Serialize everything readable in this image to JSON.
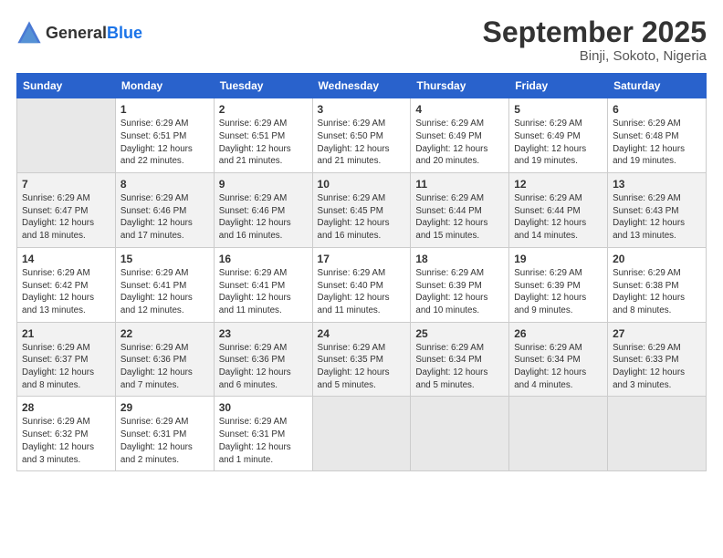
{
  "header": {
    "logo_general": "General",
    "logo_blue": "Blue",
    "month": "September 2025",
    "location": "Binji, Sokoto, Nigeria"
  },
  "weekdays": [
    "Sunday",
    "Monday",
    "Tuesday",
    "Wednesday",
    "Thursday",
    "Friday",
    "Saturday"
  ],
  "weeks": [
    [
      {
        "day": "",
        "info": ""
      },
      {
        "day": "1",
        "info": "Sunrise: 6:29 AM\nSunset: 6:51 PM\nDaylight: 12 hours\nand 22 minutes."
      },
      {
        "day": "2",
        "info": "Sunrise: 6:29 AM\nSunset: 6:51 PM\nDaylight: 12 hours\nand 21 minutes."
      },
      {
        "day": "3",
        "info": "Sunrise: 6:29 AM\nSunset: 6:50 PM\nDaylight: 12 hours\nand 21 minutes."
      },
      {
        "day": "4",
        "info": "Sunrise: 6:29 AM\nSunset: 6:49 PM\nDaylight: 12 hours\nand 20 minutes."
      },
      {
        "day": "5",
        "info": "Sunrise: 6:29 AM\nSunset: 6:49 PM\nDaylight: 12 hours\nand 19 minutes."
      },
      {
        "day": "6",
        "info": "Sunrise: 6:29 AM\nSunset: 6:48 PM\nDaylight: 12 hours\nand 19 minutes."
      }
    ],
    [
      {
        "day": "7",
        "info": "Sunrise: 6:29 AM\nSunset: 6:47 PM\nDaylight: 12 hours\nand 18 minutes."
      },
      {
        "day": "8",
        "info": "Sunrise: 6:29 AM\nSunset: 6:46 PM\nDaylight: 12 hours\nand 17 minutes."
      },
      {
        "day": "9",
        "info": "Sunrise: 6:29 AM\nSunset: 6:46 PM\nDaylight: 12 hours\nand 16 minutes."
      },
      {
        "day": "10",
        "info": "Sunrise: 6:29 AM\nSunset: 6:45 PM\nDaylight: 12 hours\nand 16 minutes."
      },
      {
        "day": "11",
        "info": "Sunrise: 6:29 AM\nSunset: 6:44 PM\nDaylight: 12 hours\nand 15 minutes."
      },
      {
        "day": "12",
        "info": "Sunrise: 6:29 AM\nSunset: 6:44 PM\nDaylight: 12 hours\nand 14 minutes."
      },
      {
        "day": "13",
        "info": "Sunrise: 6:29 AM\nSunset: 6:43 PM\nDaylight: 12 hours\nand 13 minutes."
      }
    ],
    [
      {
        "day": "14",
        "info": "Sunrise: 6:29 AM\nSunset: 6:42 PM\nDaylight: 12 hours\nand 13 minutes."
      },
      {
        "day": "15",
        "info": "Sunrise: 6:29 AM\nSunset: 6:41 PM\nDaylight: 12 hours\nand 12 minutes."
      },
      {
        "day": "16",
        "info": "Sunrise: 6:29 AM\nSunset: 6:41 PM\nDaylight: 12 hours\nand 11 minutes."
      },
      {
        "day": "17",
        "info": "Sunrise: 6:29 AM\nSunset: 6:40 PM\nDaylight: 12 hours\nand 11 minutes."
      },
      {
        "day": "18",
        "info": "Sunrise: 6:29 AM\nSunset: 6:39 PM\nDaylight: 12 hours\nand 10 minutes."
      },
      {
        "day": "19",
        "info": "Sunrise: 6:29 AM\nSunset: 6:39 PM\nDaylight: 12 hours\nand 9 minutes."
      },
      {
        "day": "20",
        "info": "Sunrise: 6:29 AM\nSunset: 6:38 PM\nDaylight: 12 hours\nand 8 minutes."
      }
    ],
    [
      {
        "day": "21",
        "info": "Sunrise: 6:29 AM\nSunset: 6:37 PM\nDaylight: 12 hours\nand 8 minutes."
      },
      {
        "day": "22",
        "info": "Sunrise: 6:29 AM\nSunset: 6:36 PM\nDaylight: 12 hours\nand 7 minutes."
      },
      {
        "day": "23",
        "info": "Sunrise: 6:29 AM\nSunset: 6:36 PM\nDaylight: 12 hours\nand 6 minutes."
      },
      {
        "day": "24",
        "info": "Sunrise: 6:29 AM\nSunset: 6:35 PM\nDaylight: 12 hours\nand 5 minutes."
      },
      {
        "day": "25",
        "info": "Sunrise: 6:29 AM\nSunset: 6:34 PM\nDaylight: 12 hours\nand 5 minutes."
      },
      {
        "day": "26",
        "info": "Sunrise: 6:29 AM\nSunset: 6:34 PM\nDaylight: 12 hours\nand 4 minutes."
      },
      {
        "day": "27",
        "info": "Sunrise: 6:29 AM\nSunset: 6:33 PM\nDaylight: 12 hours\nand 3 minutes."
      }
    ],
    [
      {
        "day": "28",
        "info": "Sunrise: 6:29 AM\nSunset: 6:32 PM\nDaylight: 12 hours\nand 3 minutes."
      },
      {
        "day": "29",
        "info": "Sunrise: 6:29 AM\nSunset: 6:31 PM\nDaylight: 12 hours\nand 2 minutes."
      },
      {
        "day": "30",
        "info": "Sunrise: 6:29 AM\nSunset: 6:31 PM\nDaylight: 12 hours\nand 1 minute."
      },
      {
        "day": "",
        "info": ""
      },
      {
        "day": "",
        "info": ""
      },
      {
        "day": "",
        "info": ""
      },
      {
        "day": "",
        "info": ""
      }
    ]
  ]
}
